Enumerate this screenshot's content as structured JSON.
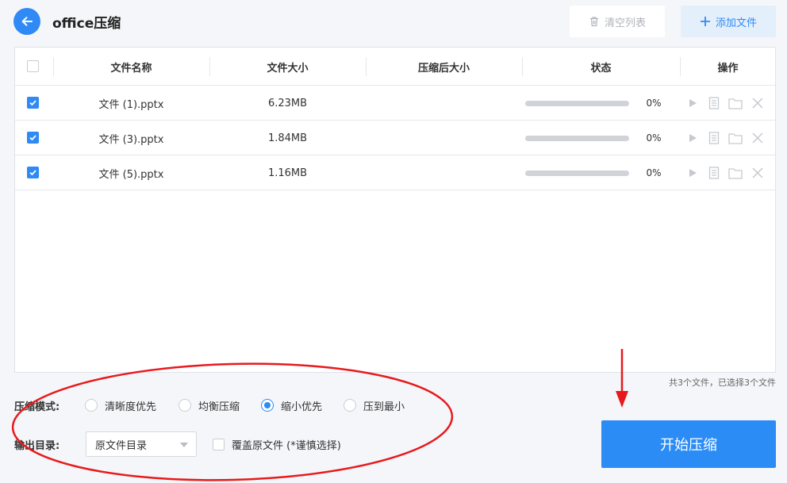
{
  "header": {
    "title": "office压缩",
    "clear_label": "清空列表",
    "add_label": "添加文件"
  },
  "table": {
    "columns": [
      "文件名称",
      "文件大小",
      "压缩后大小",
      "状态",
      "操作"
    ],
    "rows": [
      {
        "name": "文件 (1).pptx",
        "size": "6.23MB",
        "compressed": "",
        "progress": 0,
        "progress_text": "0%",
        "checked": true
      },
      {
        "name": "文件 (3).pptx",
        "size": "1.84MB",
        "compressed": "",
        "progress": 0,
        "progress_text": "0%",
        "checked": true
      },
      {
        "name": "文件 (5).pptx",
        "size": "1.16MB",
        "compressed": "",
        "progress": 0,
        "progress_text": "0%",
        "checked": true
      }
    ],
    "summary": "共3个文件，已选择3个文件"
  },
  "options": {
    "mode_label": "压缩模式:",
    "modes": [
      "清晰度优先",
      "均衡压缩",
      "缩小优先",
      "压到最小"
    ],
    "selected_mode": "缩小优先",
    "output_label": "输出目录:",
    "output_value": "原文件目录",
    "overwrite_label": "覆盖原文件 (*谨慎选择)",
    "overwrite_checked": false
  },
  "start_label": "开始压缩",
  "colors": {
    "accent": "#2f8af5",
    "annotation": "#e8191c"
  },
  "icons": [
    "arrow-left-icon",
    "trash-icon",
    "plus-icon",
    "check-icon",
    "play-icon",
    "document-icon",
    "folder-icon",
    "close-icon",
    "caret-down-icon"
  ]
}
